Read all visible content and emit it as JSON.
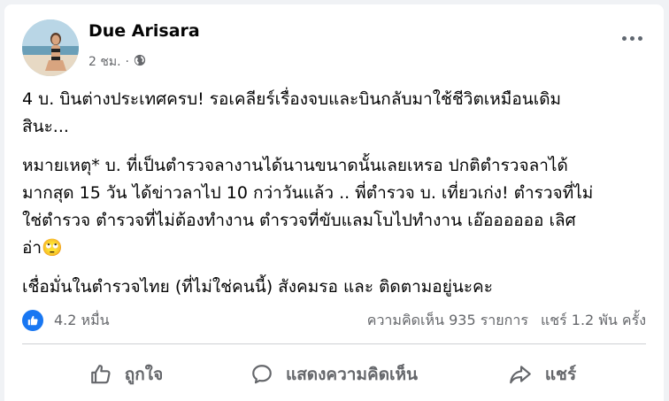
{
  "post": {
    "author": "Due Arisara",
    "time": "2 ชม.",
    "separator": "·",
    "paragraphs": [
      "4 บ. บินต่างประเทศครบ! รอเคลียร์เรื่องจบและบินกลับมาใช้ชีวิตเหมือนเดิม\nสินะ...",
      "หมายเหตุ* บ. ที่เป็นตำรวจลางานได้นานขนาดนั้นเลยเหรอ ปกติตำรวจลาได้\nมากสุด 15 วัน ได้ข่าวลาไป 10 กว่าวันแล้ว .. พี่ตำรวจ บ. เที่ยวเก่ง! ตำรวจที่ไม่\nใช่ตำรวจ ตำรวจที่ไม่ต้องทำงาน ตำรวจที่ขับแลมโบไปทำงาน เอ๊ออออออ เลิศ\nอ่า🙄",
      "เชื่อมั่นในตำรวจไทย (ที่ไม่ใช่คนนี้) สังคมรอ และ ติดตามอยู่นะคะ"
    ]
  },
  "stats": {
    "likes": "4.2 หมื่น",
    "comments": "ความคิดเห็น 935 รายการ",
    "shares": "แชร์ 1.2 พัน ครั้ง"
  },
  "actions": {
    "like": "ถูกใจ",
    "comment": "แสดงความคิดเห็น",
    "share": "แชร์"
  },
  "icons": {
    "privacy": "globe-icon",
    "reaction": "like-icon",
    "more": "more-options-icon"
  },
  "colors": {
    "accent": "#1877f2",
    "secondary_text": "#65676b"
  }
}
